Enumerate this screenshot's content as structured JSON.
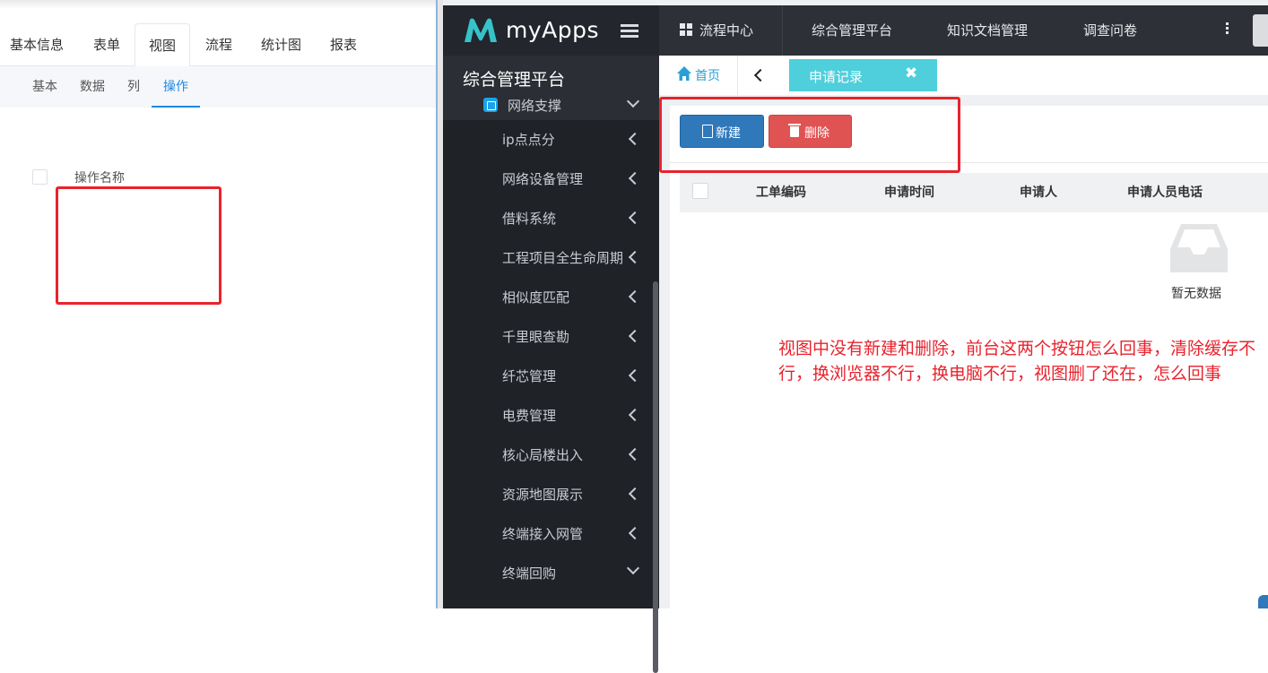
{
  "left_panel": {
    "tabs": [
      "基本信息",
      "表单",
      "视图",
      "流程",
      "统计图",
      "报表"
    ],
    "active_tab": "视图",
    "subtabs": [
      "基本",
      "数据",
      "列",
      "操作"
    ],
    "active_subtab": "操作",
    "table_header": "操作名称"
  },
  "app": {
    "logo_text": "myApps",
    "nav_items": [
      "流程中心",
      "综合管理平台",
      "知识文档管理",
      "调查问卷"
    ],
    "sidebar_title": "综合管理平台",
    "sidebar_group": "网络支撑",
    "sidebar_items": [
      {
        "label": "ip点点分",
        "state": "collapsed"
      },
      {
        "label": "网络设备管理",
        "state": "collapsed"
      },
      {
        "label": "借料系统",
        "state": "collapsed"
      },
      {
        "label": "工程项目全生命周期",
        "state": "collapsed"
      },
      {
        "label": "相似度匹配",
        "state": "collapsed"
      },
      {
        "label": "千里眼查勘",
        "state": "collapsed"
      },
      {
        "label": "纤芯管理",
        "state": "collapsed"
      },
      {
        "label": "电费管理",
        "state": "collapsed"
      },
      {
        "label": "核心局楼出入",
        "state": "collapsed"
      },
      {
        "label": "资源地图展示",
        "state": "collapsed"
      },
      {
        "label": "终端接入网管",
        "state": "collapsed"
      },
      {
        "label": "终端回购",
        "state": "expanded"
      }
    ],
    "home_label": "首页",
    "active_tab_label": "申请记录",
    "close_glyph": "✖",
    "buttons": {
      "new": "新建",
      "delete": "删除"
    },
    "table_headers": [
      "工单编码",
      "申请时间",
      "申请人",
      "申请人员电话"
    ],
    "empty_text": "暂无数据",
    "colors": {
      "accent": "#4ecfdb",
      "primary": "#2f78ba",
      "danger": "#e05353",
      "annotation": "#e8232d"
    }
  },
  "annotation": {
    "note": "视图中没有新建和删除，前台这两个按钮怎么回事，清除缓存不行，换浏览器不行，换电脑不行，视图删了还在，怎么回事"
  }
}
